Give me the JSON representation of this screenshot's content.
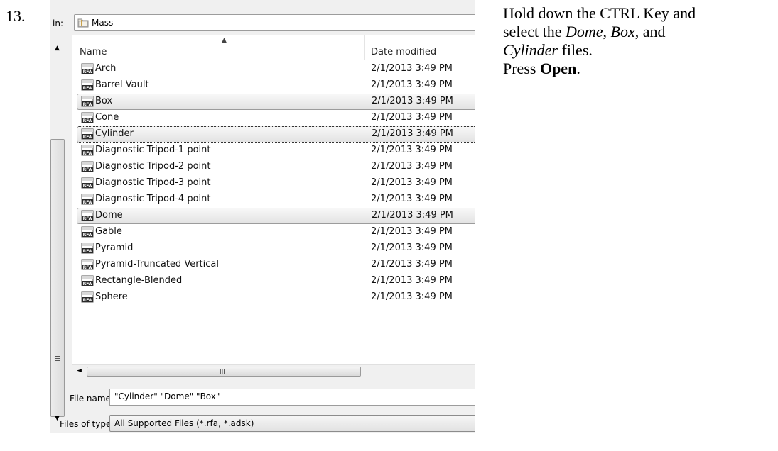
{
  "step": {
    "number": "13.",
    "line1": "Hold down the CTRL Key and",
    "line2_before": "select the ",
    "line2_dome": "Dome",
    "line2_mid": ", ",
    "line2_box": "Box",
    "line2_after": ", and",
    "line3_cylinder": "Cylinder",
    "line3_after": " files.",
    "line4_before": "Press ",
    "line4_open": "Open",
    "line4_after": "."
  },
  "dialog": {
    "look_in_label": "in:",
    "look_in_value": "Mass",
    "columns": {
      "name": "Name",
      "date": "Date modified"
    },
    "files": [
      {
        "name": "Arch",
        "date": "2/1/2013 3:49 PM",
        "selected": false
      },
      {
        "name": "Barrel Vault",
        "date": "2/1/2013 3:49 PM",
        "selected": false
      },
      {
        "name": "Box",
        "date": "2/1/2013 3:49 PM",
        "selected": true
      },
      {
        "name": "Cone",
        "date": "2/1/2013 3:49 PM",
        "selected": false
      },
      {
        "name": "Cylinder",
        "date": "2/1/2013 3:49 PM",
        "selected": true,
        "focused": true
      },
      {
        "name": "Diagnostic Tripod-1 point",
        "date": "2/1/2013 3:49 PM",
        "selected": false
      },
      {
        "name": "Diagnostic Tripod-2 point",
        "date": "2/1/2013 3:49 PM",
        "selected": false
      },
      {
        "name": "Diagnostic Tripod-3 point",
        "date": "2/1/2013 3:49 PM",
        "selected": false
      },
      {
        "name": "Diagnostic Tripod-4 point",
        "date": "2/1/2013 3:49 PM",
        "selected": false
      },
      {
        "name": "Dome",
        "date": "2/1/2013 3:49 PM",
        "selected": true
      },
      {
        "name": "Gable",
        "date": "2/1/2013 3:49 PM",
        "selected": false
      },
      {
        "name": "Pyramid",
        "date": "2/1/2013 3:49 PM",
        "selected": false
      },
      {
        "name": "Pyramid-Truncated Vertical",
        "date": "2/1/2013 3:49 PM",
        "selected": false
      },
      {
        "name": "Rectangle-Blended",
        "date": "2/1/2013 3:49 PM",
        "selected": false
      },
      {
        "name": "Sphere",
        "date": "2/1/2013 3:49 PM",
        "selected": false
      }
    ],
    "file_icon_label": "RFA",
    "hscroll_grip": "III",
    "file_name_label": "File name:",
    "file_name_value": "\"Cylinder\" \"Dome\" \"Box\"",
    "file_type_label": "Files of type:",
    "file_type_value": "All Supported Files  (*.rfa, *.adsk)"
  }
}
